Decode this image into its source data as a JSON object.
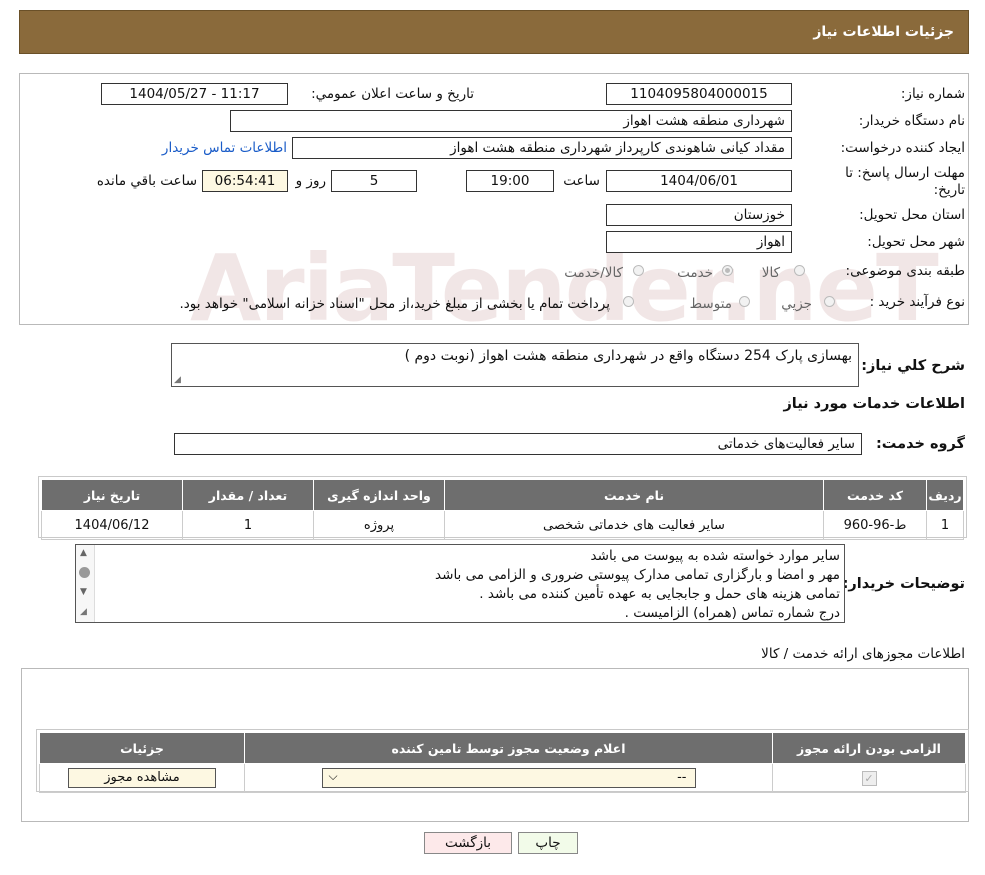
{
  "header": {
    "title": "جزئیات اطلاعات نیاز"
  },
  "watermark": "AriaTender.neT",
  "fields": {
    "need_number_label": "شماره نیاز:",
    "need_number": "1104095804000015",
    "announce_label": "تاریخ و ساعت اعلان عمومي:",
    "announce_value": "1404/05/27 - 11:17",
    "buyer_org_label": "نام دستگاه خریدار:",
    "buyer_org": "شهرداری منطقه هشت اهواز",
    "creator_label": "ایجاد کننده درخواست:",
    "creator": "مقداد کیانی شاهوندی کارپرداز شهرداری منطقه هشت اهواز",
    "contact_link": "اطلاعات تماس خریدار",
    "deadline_label": "مهلت ارسال پاسخ: تا تاریخ:",
    "deadline_date": "1404/06/01",
    "time_label": "ساعت",
    "deadline_time": "19:00",
    "days_value": "5",
    "days_label": "روز و",
    "remaining_time": "06:54:41",
    "remaining_label": "ساعت باقي مانده",
    "province_label": "استان محل تحویل:",
    "province": "خوزستان",
    "city_label": "شهر محل تحویل:",
    "city": "اهواز",
    "category_label": "طبقه بندی موضوعی:",
    "category_options": [
      "کالا",
      "خدمت",
      "کالا/خدمت"
    ],
    "purchase_type_label": "نوع فرآیند خرید :",
    "purchase_options": [
      "جزیي",
      "متوسط"
    ],
    "purchase_note": "پرداخت تمام یا بخشی از مبلغ خرید،از محل \"اسناد خزانه اسلامی\" خواهد بود."
  },
  "summary": {
    "label": "شرح كلي نیاز:",
    "text": "بهسازی پارک 254 دستگاه واقع در شهرداری منطقه هشت اهواز (نوبت دوم )"
  },
  "services": {
    "title": "اطلاعات خدمات مورد نیاز",
    "group_label": "گروه خدمت:",
    "group_value": "سایر فعالیت‌های خدماتی",
    "headers": [
      "ردیف",
      "کد خدمت",
      "نام خدمت",
      "واحد اندازه گیری",
      "تعداد / مقدار",
      "تاریخ نیاز"
    ],
    "rows": [
      [
        "1",
        "ط-96-960",
        "سایر فعالیت های خدماتی شخصی",
        "پروژه",
        "1",
        "1404/06/12"
      ]
    ]
  },
  "buyer_notes": {
    "label": "توضیحات خریدار:",
    "lines": [
      "سایر موارد خواسته شده به پیوست می باشد",
      "مهر و امضا و بارگزاری تمامی مدارک پیوستی ضروری و الزامی می باشد",
      "تمامی هزینه های حمل و جابجایی به عهده تأمین کننده می باشد .",
      "درج شماره تماس (همراه) الزامیست ."
    ]
  },
  "permits": {
    "title": "اطلاعات مجوزهای ارائه خدمت / کالا",
    "headers": [
      "الزامی بودن ارائه مجوز",
      "اعلام وضعیت مجوز توسط تامین کننده",
      "جزئیات"
    ],
    "select_value": "--",
    "view_button": "مشاهده مجوز"
  },
  "buttons": {
    "print": "چاپ",
    "back": "بازگشت"
  },
  "colors": {
    "header": "#8a6a3b",
    "table_header": "#6e6e6e",
    "link": "#1a5cc8",
    "back_button": "#fde9ea",
    "print_button": "#f2fbe9"
  }
}
